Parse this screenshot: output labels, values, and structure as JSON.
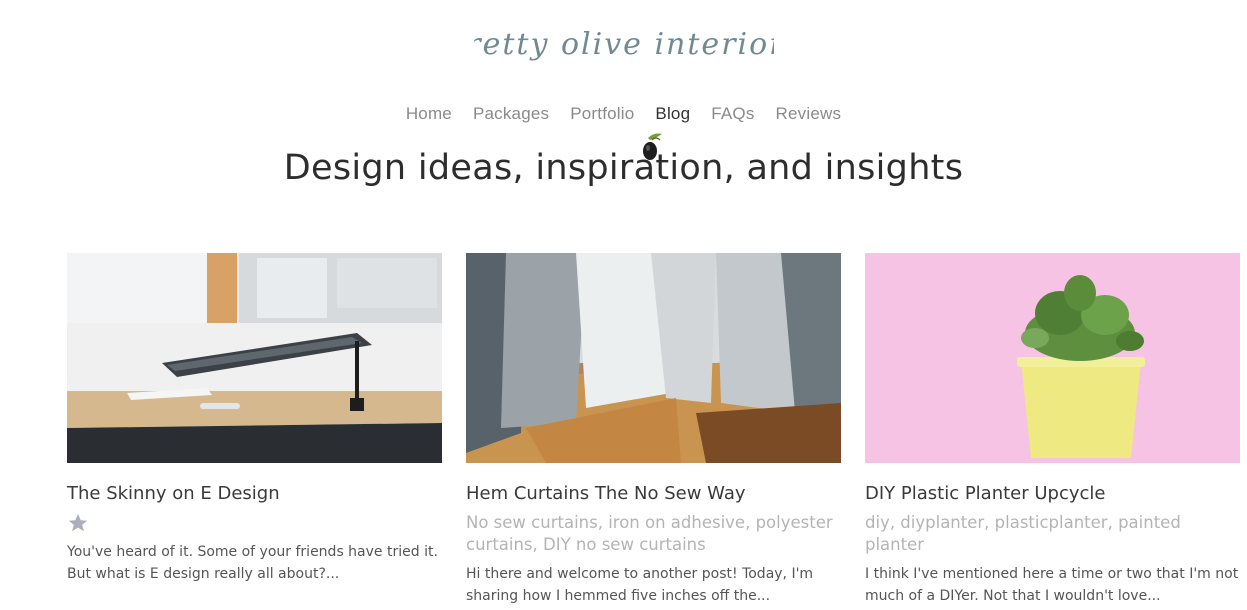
{
  "brand": {
    "name": "pretty olive interiors"
  },
  "nav": {
    "items": [
      {
        "label": "Home"
      },
      {
        "label": "Packages"
      },
      {
        "label": "Portfolio"
      },
      {
        "label": "Blog"
      },
      {
        "label": "FAQs"
      },
      {
        "label": "Reviews"
      }
    ],
    "active": "Blog"
  },
  "page": {
    "title": "Design ideas, inspiration, and insights"
  },
  "posts": [
    {
      "title": "The Skinny on E Design",
      "tags": "",
      "excerpt": "You've heard of it. Some of your friends have tried it. But what is E design really all about?..."
    },
    {
      "title": "Hem Curtains The No Sew Way",
      "tags": "No sew curtains, iron on adhesive, polyester curtains, DIY no sew curtains",
      "excerpt": "Hi there and welcome to another post! Today, I'm sharing how I hemmed five inches off the..."
    },
    {
      "title": "DIY Plastic Planter Upcycle",
      "tags": "diy, diyplanter, plasticplanter, painted planter",
      "excerpt": "I think I've mentioned here a time or two that I'm not much of a DIYer. Not that I wouldn't love..."
    }
  ],
  "colors": {
    "brand": "#6f8a92",
    "nav_text": "#8a8a8a",
    "nav_active": "#333333",
    "tag_text": "#b4b4b4",
    "star": "#a9afbd",
    "planter_bg": "#f6c3e4",
    "planter_pot": "#eee981"
  }
}
